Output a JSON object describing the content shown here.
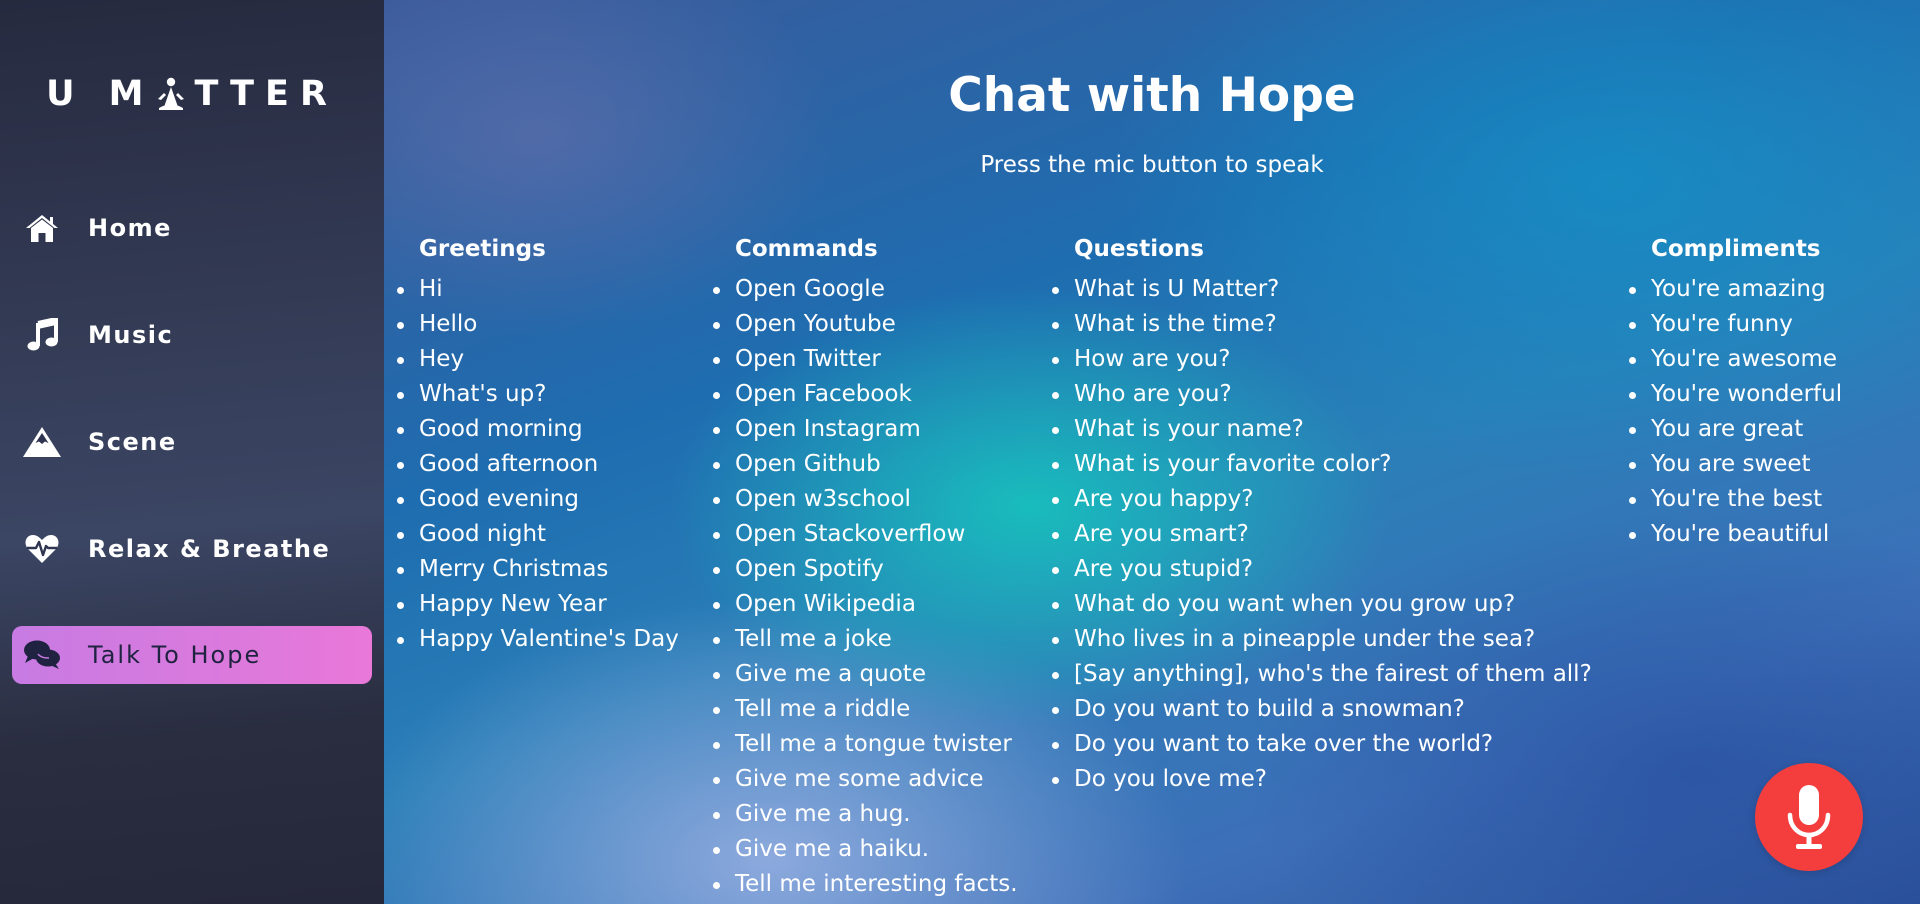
{
  "sidebar": {
    "logo_left": "U M",
    "logo_right": "TTER",
    "items": [
      {
        "label": "Home",
        "icon": "home-icon"
      },
      {
        "label": "Music",
        "icon": "music-icon"
      },
      {
        "label": "Scene",
        "icon": "mountain-icon"
      },
      {
        "label": "Relax & Breathe",
        "icon": "heartbeat-icon"
      },
      {
        "label": "Talk To Hope",
        "icon": "chat-bubbles-icon",
        "active": true
      }
    ],
    "active_gradient": [
      "#c77be3",
      "#e978d9"
    ]
  },
  "main": {
    "title": "Chat with Hope",
    "subtitle": "Press the mic button to speak",
    "columns": [
      {
        "heading": "Greetings",
        "items": [
          "Hi",
          "Hello",
          "Hey",
          "What's up?",
          "Good morning",
          "Good afternoon",
          "Good evening",
          "Good night",
          "Merry Christmas",
          "Happy New Year",
          "Happy Valentine's Day"
        ]
      },
      {
        "heading": "Commands",
        "items": [
          "Open Google",
          "Open Youtube",
          "Open Twitter",
          "Open Facebook",
          "Open Instagram",
          "Open Github",
          "Open w3school",
          "Open Stackoverflow",
          "Open Spotify",
          "Open Wikipedia",
          "Tell me a joke",
          "Give me a quote",
          "Tell me a riddle",
          "Tell me a tongue twister",
          "Give me some advice",
          "Give me a hug.",
          "Give me a haiku.",
          "Tell me interesting facts."
        ]
      },
      {
        "heading": "Questions",
        "items": [
          "What is U Matter?",
          "What is the time?",
          "How are you?",
          "Who are you?",
          "What is your name?",
          "What is your favorite color?",
          "Are you happy?",
          "Are you smart?",
          "Are you stupid?",
          "What do you want when you grow up?",
          "Who lives in a pineapple under the sea?",
          "[Say anything], who's the fairest of them all?",
          "Do you want to build a snowman?",
          "Do you want to take over the world?",
          "Do you love me?"
        ]
      },
      {
        "heading": "Compliments",
        "items": [
          "You're amazing",
          "You're funny",
          "You're awesome",
          "You're wonderful",
          "You are great",
          "You are sweet",
          "You're the best",
          "You're beautiful"
        ]
      }
    ],
    "mic": {
      "icon": "microphone-icon",
      "color": "#f43d3d"
    }
  }
}
